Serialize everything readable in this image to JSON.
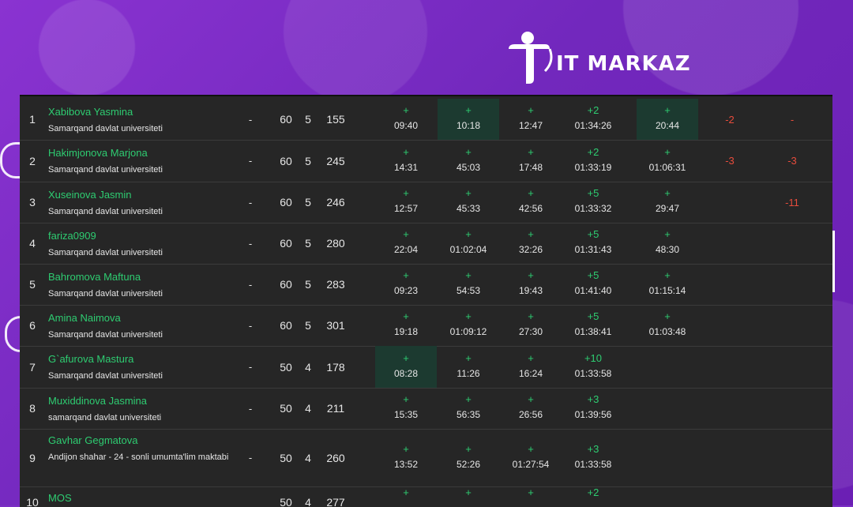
{
  "brand": {
    "logo_text": "IT MARKAZ"
  },
  "colors": {
    "accent": "#2ecc71",
    "negative": "#e74c3c",
    "first_solve_bg": "#1c3a30",
    "board_bg": "#262626",
    "page_bg": "#7b2fc4"
  },
  "rows": [
    {
      "rank": "1",
      "name": "Xabibova Yasmina",
      "org": "Samarqand davlat universiteti",
      "dash": "-",
      "score": "60",
      "solved": "5",
      "penalty": "155",
      "problems": [
        {
          "mark": "+",
          "time": "09:40",
          "first": false
        },
        {
          "mark": "+",
          "time": "10:18",
          "first": true
        },
        {
          "mark": "+",
          "time": "12:47",
          "first": false
        },
        {
          "mark": "+2",
          "time": "01:34:26",
          "first": false
        },
        {
          "mark": "+",
          "time": "20:44",
          "first": true
        },
        {
          "mark": "-2",
          "time": "",
          "neg": true
        },
        {
          "mark": "-",
          "time": "",
          "neg": true
        }
      ]
    },
    {
      "rank": "2",
      "name": "Hakimjonova Marjona",
      "org": "Samarqand davlat universiteti",
      "dash": "-",
      "score": "60",
      "solved": "5",
      "penalty": "245",
      "problems": [
        {
          "mark": "+",
          "time": "14:31"
        },
        {
          "mark": "+",
          "time": "45:03"
        },
        {
          "mark": "+",
          "time": "17:48"
        },
        {
          "mark": "+2",
          "time": "01:33:19"
        },
        {
          "mark": "+",
          "time": "01:06:31"
        },
        {
          "mark": "-3",
          "time": "",
          "neg": true
        },
        {
          "mark": "-3",
          "time": "",
          "neg": true
        }
      ]
    },
    {
      "rank": "3",
      "name": "Xuseinova Jasmin",
      "org": "Samarqand davlat universiteti",
      "dash": "-",
      "score": "60",
      "solved": "5",
      "penalty": "246",
      "problems": [
        {
          "mark": "+",
          "time": "12:57"
        },
        {
          "mark": "+",
          "time": "45:33"
        },
        {
          "mark": "+",
          "time": "42:56"
        },
        {
          "mark": "+5",
          "time": "01:33:32"
        },
        {
          "mark": "+",
          "time": "29:47"
        },
        {
          "mark": "",
          "time": ""
        },
        {
          "mark": "-11",
          "time": "",
          "neg": true
        }
      ]
    },
    {
      "rank": "4",
      "name": "fariza0909",
      "org": "Samarqand davlat universiteti",
      "dash": "-",
      "score": "60",
      "solved": "5",
      "penalty": "280",
      "problems": [
        {
          "mark": "+",
          "time": "22:04"
        },
        {
          "mark": "+",
          "time": "01:02:04"
        },
        {
          "mark": "+",
          "time": "32:26"
        },
        {
          "mark": "+5",
          "time": "01:31:43"
        },
        {
          "mark": "+",
          "time": "48:30"
        }
      ]
    },
    {
      "rank": "5",
      "name": "Bahromova Maftuna",
      "org": "Samarqand davlat universiteti",
      "dash": "-",
      "score": "60",
      "solved": "5",
      "penalty": "283",
      "problems": [
        {
          "mark": "+",
          "time": "09:23"
        },
        {
          "mark": "+",
          "time": "54:53"
        },
        {
          "mark": "+",
          "time": "19:43"
        },
        {
          "mark": "+5",
          "time": "01:41:40"
        },
        {
          "mark": "+",
          "time": "01:15:14"
        }
      ]
    },
    {
      "rank": "6",
      "name": "Amina Naimova",
      "org": "Samarqand davlat universiteti",
      "dash": "-",
      "score": "60",
      "solved": "5",
      "penalty": "301",
      "problems": [
        {
          "mark": "+",
          "time": "19:18"
        },
        {
          "mark": "+",
          "time": "01:09:12"
        },
        {
          "mark": "+",
          "time": "27:30"
        },
        {
          "mark": "+5",
          "time": "01:38:41"
        },
        {
          "mark": "+",
          "time": "01:03:48"
        }
      ]
    },
    {
      "rank": "7",
      "name": "G`afurova Mastura",
      "org": "Samarqand davlat universiteti",
      "dash": "-",
      "score": "50",
      "solved": "4",
      "penalty": "178",
      "problems": [
        {
          "mark": "+",
          "time": "08:28",
          "first": true
        },
        {
          "mark": "+",
          "time": "11:26"
        },
        {
          "mark": "+",
          "time": "16:24"
        },
        {
          "mark": "+10",
          "time": "01:33:58"
        }
      ]
    },
    {
      "rank": "8",
      "name": "Muxiddinova Jasmina",
      "org": "samarqand davlat universiteti",
      "dash": "-",
      "score": "50",
      "solved": "4",
      "penalty": "211",
      "problems": [
        {
          "mark": "+",
          "time": "15:35"
        },
        {
          "mark": "+",
          "time": "56:35"
        },
        {
          "mark": "+",
          "time": "26:56"
        },
        {
          "mark": "+3",
          "time": "01:39:56"
        }
      ]
    },
    {
      "rank": "9",
      "name": "Gavhar Gegmatova",
      "org": "Andijon shahar - 24 - sonli umumta'lim maktabi",
      "dash": "-",
      "score": "50",
      "solved": "4",
      "penalty": "260",
      "problems": [
        {
          "mark": "+",
          "time": "13:52"
        },
        {
          "mark": "+",
          "time": "52:26"
        },
        {
          "mark": "+",
          "time": "01:27:54"
        },
        {
          "mark": "+3",
          "time": "01:33:58"
        }
      ]
    },
    {
      "rank": "10",
      "name": "MOS",
      "org": "",
      "dash": "",
      "score": "50",
      "solved": "4",
      "penalty": "277",
      "problems": [
        {
          "mark": "+",
          "time": ""
        },
        {
          "mark": "+",
          "time": ""
        },
        {
          "mark": "+",
          "time": ""
        },
        {
          "mark": "+2",
          "time": ""
        }
      ]
    }
  ]
}
